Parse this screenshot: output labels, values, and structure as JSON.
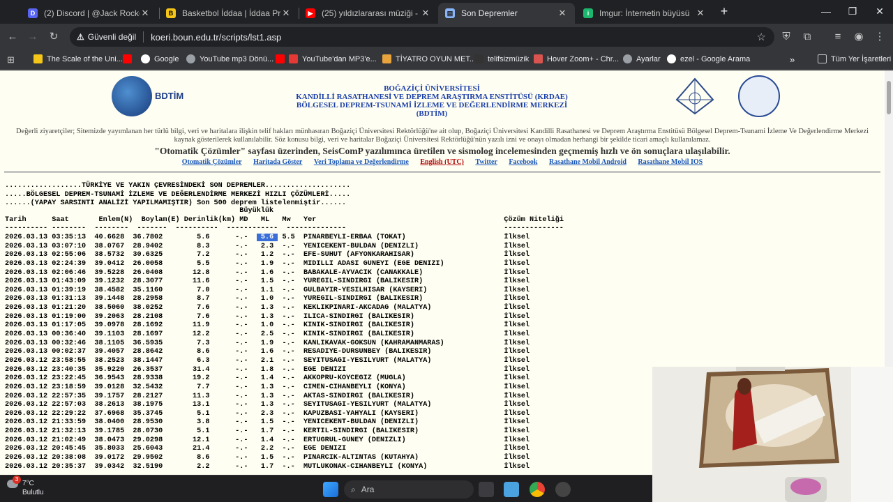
{
  "browser": {
    "tabs": [
      {
        "title": "(2) Discord | @Jack Rocker",
        "fav": "#5865f2"
      },
      {
        "title": "Basketbol İddaa | İddaa Program",
        "fav": "#f5c518"
      },
      {
        "title": "(25) yıldızlararası müziği - YouT",
        "fav": "#ff0000"
      },
      {
        "title": "Son Depremler",
        "fav": "#8ab4f8"
      },
      {
        "title": "Imgur: İnternetin büyüsü",
        "fav": "#1bb76e"
      }
    ],
    "active_tab": 3,
    "security_label": "Güvenli değil",
    "url": "koeri.boun.edu.tr/scripts/lst1.asp",
    "bookmarks": [
      "The Scale of the Uni...",
      "Google",
      "YouTube mp3 Dönü...",
      "YouTube'dan MP3'e...",
      "TİYATRO OYUN MET...",
      "telifsizmüzik",
      "Hover Zoom+ - Chr...",
      "Ayarlar",
      "ezel - Google Arama"
    ],
    "all_bookmarks": "Tüm Yer İşaretleri"
  },
  "site": {
    "logo_text": "BDTİM",
    "header_lines": [
      "BOĞAZİÇİ ÜNİVERSİTESİ",
      "KANDİLLİ RASATHANESİ VE DEPREM ARAŞTIRMA ENSTİTÜSÜ (KRDAE)",
      "BÖLGESEL DEPREM-TSUNAMİ İZLEME VE DEĞERLENDİRME MERKEZİ (BDTİM)"
    ],
    "notice": "Değerli ziyaretçiler; Sitemizde yayımlanan her türlü bilgi, veri ve haritalara ilişkin telif hakları münhasıran Boğaziçi Üniversitesi Rektörlüğü'ne ait olup, Boğaziçi Üniversitesi Kandilli Rasathanesi ve Deprem Araştırma Enstitüsü Bölgesel Deprem-Tsunami İzleme Ve Değerlendirme Merkezi kaynak gösterilerek kullanılabilir. Söz konusu bilgi, veri ve haritalar Boğaziçi Üniversitesi Rektörlüğü'nün yazılı izni ve onayı olmadan herhangi bir şekilde ticari amaçlı kullanılamaz.",
    "automatic_note": "\"Otomatik Çözümler\" sayfası üzerinden, SeisComP yazılımınca üretilen ve sismolog incelemesinden geçmemiş hızlı ve ön sonuçlara ulaşılabilir.",
    "nav": [
      "Otomatik Çözümler",
      "Haritada Göster",
      "Veri Toplama ve Değerlendirme",
      "English (UTC)",
      "Twitter",
      "Facebook",
      "Rasathane Mobil Android",
      "Rasathane Mobil IOS"
    ]
  },
  "listing": {
    "intro1": "..................TÜRKİYE VE YAKIN ÇEVRESİNDEKİ SON DEPREMLER....................",
    "intro2": ".....BÖLGESEL DEPREM-TSUNAMİ İZLEME VE DEĞERLENDİRME MERKEZİ HIZLI ÇÖZÜMLERİ.....",
    "intro3": "......(YAPAY SARSINTI ANALİZİ YAPILMAMIŞTIR) Son 500 deprem listelenmiştir......",
    "mag_header": "Büyüklük",
    "columns": [
      "Tarih",
      "Saat",
      "Enlem(N)",
      "Boylam(E)",
      "Derinlik(km)",
      "MD",
      "ML",
      "Mw",
      "Yer",
      "Çözüm Niteliği"
    ],
    "rows": [
      [
        "2026.03.13",
        "03:35:13",
        "40.6628",
        "36.7802",
        "5.6",
        "-.-",
        "5.6",
        "5.5",
        "PINARBEYLI-ERBAA (TOKAT)",
        "İlksel"
      ],
      [
        "2026.03.13",
        "03:07:10",
        "38.0767",
        "28.9402",
        "8.3",
        "-.-",
        "2.3",
        "-.-",
        "YENICEKENT-BULDAN (DENIZLI)",
        "İlksel"
      ],
      [
        "2026.03.13",
        "02:55:06",
        "38.5732",
        "30.6325",
        "7.2",
        "-.-",
        "1.2",
        "-.-",
        "EFE-SUHUT (AFYONKARAHISAR)",
        "İlksel"
      ],
      [
        "2026.03.13",
        "02:24:39",
        "39.0412",
        "26.0058",
        "5.5",
        "-.-",
        "1.9",
        "-.-",
        "MIDILLI ADASI GUNEYI (EGE DENIZI)",
        "İlksel"
      ],
      [
        "2026.03.13",
        "02:06:46",
        "39.5228",
        "26.0408",
        "12.8",
        "-.-",
        "1.6",
        "-.-",
        "BABAKALE-AYVACIK (CANAKKALE)",
        "İlksel"
      ],
      [
        "2026.03.13",
        "01:43:09",
        "39.1232",
        "28.3077",
        "11.6",
        "-.-",
        "1.5",
        "-.-",
        "YUREGIL-SINDIRGI (BALIKESIR)",
        "İlksel"
      ],
      [
        "2026.03.13",
        "01:39:19",
        "38.4582",
        "35.1160",
        "7.0",
        "-.-",
        "1.1",
        "-.-",
        "GULBAYIR-YESILHISAR (KAYSERI)",
        "İlksel"
      ],
      [
        "2026.03.13",
        "01:31:13",
        "39.1448",
        "28.2958",
        "8.7",
        "-.-",
        "1.0",
        "-.-",
        "YUREGIL-SINDIRGI (BALIKESIR)",
        "İlksel"
      ],
      [
        "2026.03.13",
        "01:21:20",
        "38.5060",
        "38.0252",
        "7.6",
        "-.-",
        "1.3",
        "-.-",
        "KEKLIKPINARI-AKCADAG (MALATYA)",
        "İlksel"
      ],
      [
        "2026.03.13",
        "01:19:00",
        "39.2063",
        "28.2108",
        "7.6",
        "-.-",
        "1.3",
        "-.-",
        "ILICA-SINDIRGI (BALIKESIR)",
        "İlksel"
      ],
      [
        "2026.03.13",
        "01:17:05",
        "39.0978",
        "28.1692",
        "11.9",
        "-.-",
        "1.0",
        "-.-",
        "KINIK-SINDIRGI (BALIKESIR)",
        "İlksel"
      ],
      [
        "2026.03.13",
        "00:36:40",
        "39.1103",
        "28.1697",
        "12.2",
        "-.-",
        "2.5",
        "-.-",
        "KINIK-SINDIRGI (BALIKESIR)",
        "İlksel"
      ],
      [
        "2026.03.13",
        "00:32:46",
        "38.1105",
        "36.5935",
        "7.3",
        "-.-",
        "1.9",
        "-.-",
        "KANLIKAVAK-GOKSUN (KAHRAMANMARAS)",
        "İlksel"
      ],
      [
        "2026.03.13",
        "00:02:37",
        "39.4057",
        "28.8642",
        "8.6",
        "-.-",
        "1.6",
        "-.-",
        "RESADIYE-DURSUNBEY (BALIKESIR)",
        "İlksel"
      ],
      [
        "2026.03.12",
        "23:58:55",
        "38.2523",
        "38.1447",
        "6.3",
        "-.-",
        "2.1",
        "-.-",
        "SEYITUSAGI-YESILYURT (MALATYA)",
        "İlksel"
      ],
      [
        "2026.03.12",
        "23:40:35",
        "35.9220",
        "26.3537",
        "31.4",
        "-.-",
        "1.8",
        "-.-",
        "EGE DENIZI",
        "İlksel"
      ],
      [
        "2026.03.12",
        "23:22:45",
        "36.9543",
        "28.9338",
        "19.2",
        "-.-",
        "1.4",
        "-.-",
        "AKKOPRU-KOYCEGIZ (MUGLA)",
        "İlksel"
      ],
      [
        "2026.03.12",
        "23:18:59",
        "39.0128",
        "32.5432",
        "7.7",
        "-.-",
        "1.3",
        "-.-",
        "CIMEN-CIHANBEYLI (KONYA)",
        "İlksel"
      ],
      [
        "2026.03.12",
        "22:57:35",
        "39.1757",
        "28.2127",
        "11.3",
        "-.-",
        "1.3",
        "-.-",
        "AKTAS-SINDIRGI (BALIKESIR)",
        "İlksel"
      ],
      [
        "2026.03.12",
        "22:57:03",
        "38.2613",
        "38.1975",
        "13.1",
        "-.-",
        "1.3",
        "-.-",
        "SEYITUSAGI-YESILYURT (MALATYA)",
        "İlksel"
      ],
      [
        "2026.03.12",
        "22:29:22",
        "37.6968",
        "35.3745",
        "5.1",
        "-.-",
        "2.3",
        "-.-",
        "KAPUZBASI-YAHYALI (KAYSERI)",
        "İlksel"
      ],
      [
        "2026.03.12",
        "21:33:59",
        "38.0400",
        "28.9530",
        "3.8",
        "-.-",
        "1.5",
        "-.-",
        "YENICEKENT-BULDAN (DENIZLI)",
        "İlksel"
      ],
      [
        "2026.03.12",
        "21:32:13",
        "39.1785",
        "28.0730",
        "5.1",
        "-.-",
        "1.7",
        "-.-",
        "KERTIL-SINDIRGI (BALIKESIR)",
        "İlksel"
      ],
      [
        "2026.03.12",
        "21:02:49",
        "38.0473",
        "29.0298",
        "12.1",
        "-.-",
        "1.4",
        "-.-",
        "ERTUGRUL-GUNEY (DENIZLI)",
        "İlksel"
      ],
      [
        "2026.03.12",
        "20:45:45",
        "35.8033",
        "25.6043",
        "21.4",
        "-.-",
        "2.2",
        "-.-",
        "EGE DENIZI",
        "İlksel"
      ],
      [
        "2026.03.12",
        "20:38:08",
        "39.0172",
        "29.9502",
        "8.6",
        "-.-",
        "1.5",
        "-.-",
        "PINARCIK-ALTINTAS (KUTAHYA)",
        "İlksel"
      ],
      [
        "2026.03.12",
        "20:35:37",
        "39.0342",
        "32.5190",
        "2.2",
        "-.-",
        "1.7",
        "-.-",
        "MUTLUKONAK-CIHANBEYLI (KONYA)",
        "İlksel"
      ]
    ]
  },
  "taskbar": {
    "temp": "7°C",
    "weather": "Bulutlu",
    "badge": "3",
    "search": "Ara"
  }
}
